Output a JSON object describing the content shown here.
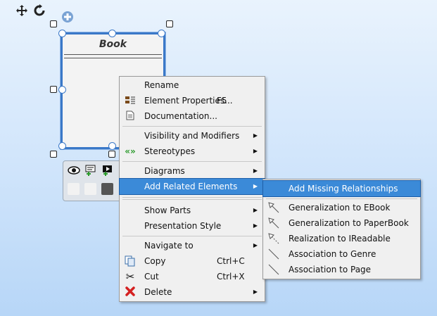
{
  "toolbar": {
    "icons": [
      "move-icon",
      "refresh-icon",
      "add-icon"
    ]
  },
  "class_box": {
    "name": "Book"
  },
  "context_menu": {
    "items": [
      {
        "label": "Rename",
        "shortcut": "",
        "submenu": false,
        "icon": ""
      },
      {
        "label": "Element Properties...",
        "shortcut": "F5",
        "submenu": false,
        "icon": "properties-icon"
      },
      {
        "label": "Documentation...",
        "shortcut": "",
        "submenu": false,
        "icon": "document-icon"
      },
      {
        "label": "Visibility and Modifiers",
        "shortcut": "",
        "submenu": true,
        "icon": ""
      },
      {
        "label": "Stereotypes",
        "shortcut": "",
        "submenu": true,
        "icon": "stereotype-icon"
      },
      {
        "label": "Diagrams",
        "shortcut": "",
        "submenu": true,
        "icon": ""
      },
      {
        "label": "Add Related Elements",
        "shortcut": "",
        "submenu": true,
        "icon": "",
        "highlighted": true
      },
      {
        "label": "Show Parts",
        "shortcut": "",
        "submenu": true,
        "icon": ""
      },
      {
        "label": "Presentation Style",
        "shortcut": "",
        "submenu": true,
        "icon": ""
      },
      {
        "label": "Navigate to",
        "shortcut": "",
        "submenu": true,
        "icon": ""
      },
      {
        "label": "Copy",
        "shortcut": "Ctrl+C",
        "submenu": false,
        "icon": "copy-icon"
      },
      {
        "label": "Cut",
        "shortcut": "Ctrl+X",
        "submenu": false,
        "icon": "scissors-icon"
      },
      {
        "label": "Delete",
        "shortcut": "",
        "submenu": true,
        "icon": "delete-icon"
      }
    ]
  },
  "submenu": {
    "items": [
      {
        "label": "Add Missing Relationships",
        "icon": "",
        "highlighted": true
      },
      {
        "label": "Generalization to EBook",
        "icon": "generalization-icon"
      },
      {
        "label": "Generalization to PaperBook",
        "icon": "generalization-icon"
      },
      {
        "label": "Realization to IReadable",
        "icon": "realization-icon"
      },
      {
        "label": "Association to Genre",
        "icon": "association-icon"
      },
      {
        "label": "Association to Page",
        "icon": "association-icon"
      }
    ]
  },
  "colors": {
    "highlight": "#3b8ad8",
    "selection_border": "#3a78c8",
    "delete_red": "#d42020",
    "stereotype_green": "#2a9a2a"
  }
}
